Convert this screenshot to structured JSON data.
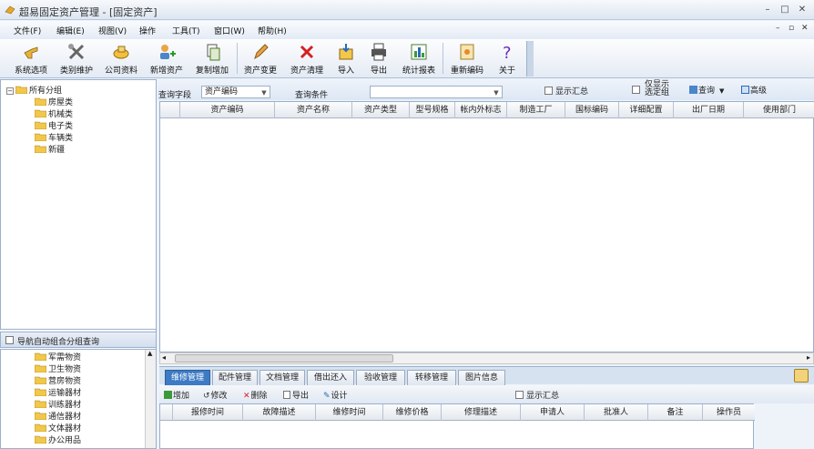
{
  "window": {
    "title": "超易固定资产管理 - [固定资产]",
    "min": "–",
    "max": "□",
    "close": "✕"
  },
  "menu": {
    "items": [
      "文件(F)",
      "编辑(E)",
      "视图(V)",
      "操作",
      "工具(T)",
      "窗口(W)",
      "帮助(H)"
    ],
    "mdi_min": "–",
    "mdi_restore": "▫",
    "mdi_close": "✕"
  },
  "toolbar": {
    "buttons": [
      "系统选项",
      "类别维护",
      "公司资料",
      "新增资产",
      "复制增加",
      "资产变更",
      "资产清理",
      "导入",
      "导出",
      "统计报表",
      "重新编码",
      "关于"
    ]
  },
  "tree": {
    "root": "所有分组",
    "children": [
      "房屋类",
      "机械类",
      "电子类",
      "车辆类",
      "新疆"
    ]
  },
  "nav": {
    "label": "导航自动组合分组查询",
    "items": [
      "军需物资",
      "卫生物资",
      "营房物资",
      "运输器材",
      "训练器材",
      "通信器材",
      "文体器材",
      "办公用品"
    ]
  },
  "query": {
    "field_label": "查询字段",
    "field_value": "资产编码",
    "cond_label": "查询条件",
    "cond_value": "",
    "show_summary": "显示汇总",
    "only_selected_line1": "仅显示",
    "only_selected_line2": "选定组",
    "query_btn": "查询",
    "advanced_btn": "高级"
  },
  "grid": {
    "columns": [
      "资产编码",
      "资产名称",
      "资产类型",
      "型号规格",
      "帐内外标志",
      "制造工厂",
      "国标编码",
      "详细配置",
      "出厂日期",
      "使用部门"
    ]
  },
  "tabs": [
    "维修管理",
    "配件管理",
    "文档管理",
    "借出还入",
    "验收管理",
    "转移管理",
    "图片信息"
  ],
  "subtoolbar": {
    "add": "增加",
    "edit": "修改",
    "delete": "删除",
    "export": "导出",
    "design": "设计",
    "show_summary": "显示汇总"
  },
  "repair_grid": {
    "columns": [
      "报修时间",
      "故障描述",
      "维修时间",
      "维修价格",
      "修理描述",
      "申请人",
      "批准人",
      "备注",
      "操作员"
    ]
  },
  "colors": {
    "accent": "#3d7bc4",
    "panel": "#dde7f4",
    "folder": "#f2c84b"
  }
}
